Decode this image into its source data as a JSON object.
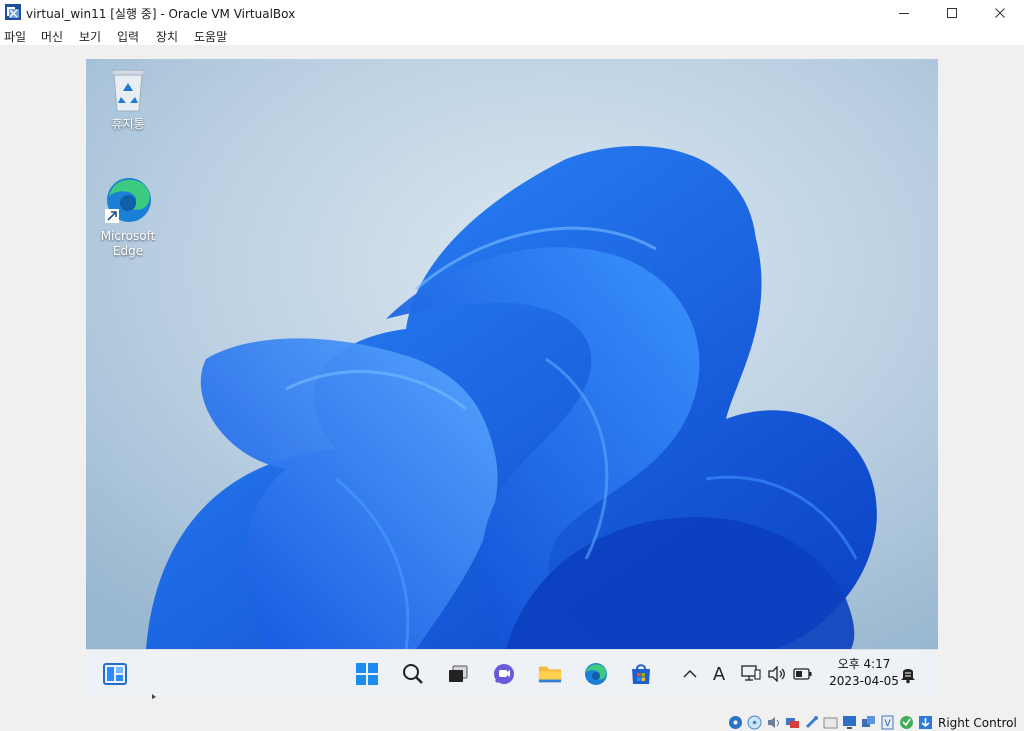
{
  "window": {
    "title": "virtual_win11 [실행 중] - Oracle VM VirtualBox",
    "controls": {
      "minimize": "—",
      "maximize": "☐",
      "close": "✕"
    }
  },
  "menubar": {
    "items": [
      "파일",
      "머신",
      "보기",
      "입력",
      "장치",
      "도움말"
    ]
  },
  "desktop": {
    "icons": [
      {
        "label": "휴지통",
        "icon": "recycle-bin-icon"
      },
      {
        "label": "Microsoft\nEdge",
        "icon": "edge-icon"
      }
    ]
  },
  "taskbar": {
    "pinned": [
      "widgets-icon",
      "start-icon",
      "search-icon",
      "task-view-icon",
      "chat-icon",
      "file-explorer-icon",
      "edge-icon",
      "store-icon"
    ],
    "tray": {
      "chevron": "^",
      "ime": "A",
      "time": "오후 4:17",
      "date": "2023-04-05"
    }
  },
  "statusbar": {
    "icons": [
      "hard-disk-icon",
      "optical-drive-icon",
      "audio-icon",
      "network-icon",
      "usb-icon",
      "shared-folders-icon",
      "display-icon",
      "recording-icon",
      "cpu-icon",
      "mouse-integration-icon",
      "keyboard-icon"
    ],
    "host_key": "Right Control"
  },
  "colors": {
    "accent": "#0078d4",
    "wallpaper_bg": "#b8cfe0",
    "bloom": "#1e6cf0",
    "taskbar": "#eef1f6"
  }
}
